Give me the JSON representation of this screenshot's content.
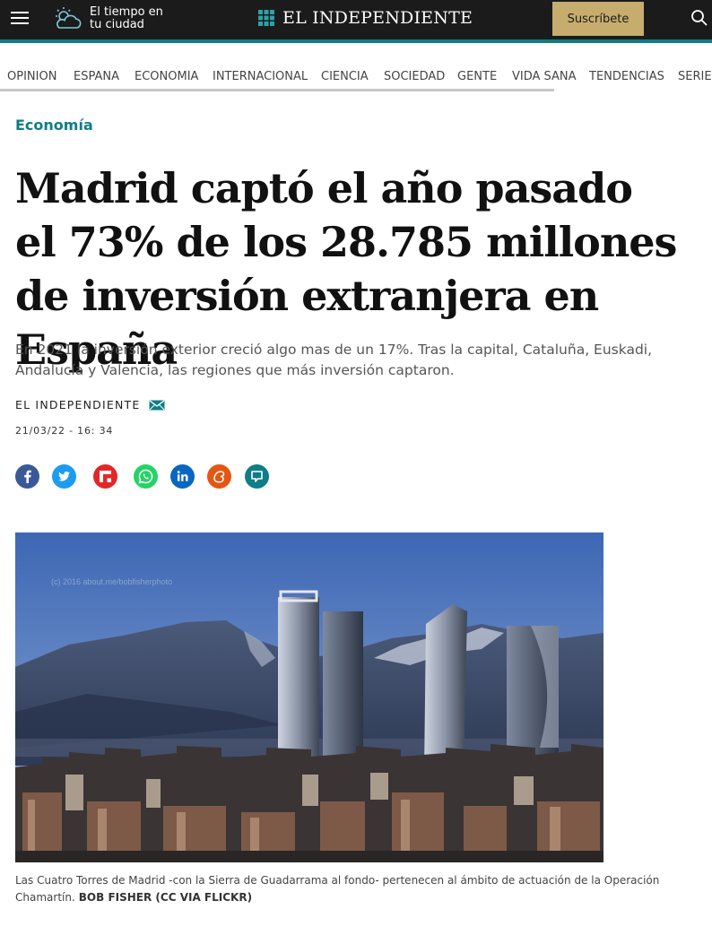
{
  "header": {
    "weather_line1": "El tiempo en",
    "weather_line2": "tu ciudad",
    "logo": "EL INDEPENDIENTE",
    "subscribe_label": "Suscríbete",
    "accent_color": "#0f7e86",
    "subscribe_color": "#c6ad6e"
  },
  "nav": {
    "items": [
      "OPINIÓN",
      "ESPAÑA",
      "ECONOMÍA",
      "INTERNACIONAL",
      "CIENCIA",
      "SOCIEDAD",
      "GENTE",
      "VIDA SANA",
      "TENDENCIAS",
      "SERIES"
    ]
  },
  "article": {
    "section": "Economía",
    "headline": "Madrid captó el año pasado el 73% de los 28.785 millones de inversión extranjera en España",
    "standfirst": "En 2021 la inversión exterior creció algo mas de un 17%. Tras la capital, Cataluña, Euskadi, Andalucía y Valencia, las regiones que más inversión captaron.",
    "author": "EL INDEPENDIENTE",
    "date": "21/03/22 - 16: 34",
    "photo_watermark": "(c) 2016 about.me/bobfisherphoto",
    "caption": "Las Cuatro Torres de Madrid -con la Sierra de Guadarrama al fondo- pertenecen al ámbito de actuación de la Operación Chamartín.",
    "credit": "BOB FISHER (CC VIA FLICKR)"
  },
  "share_buttons": [
    {
      "icon": "facebook-icon",
      "color": "#3b5998"
    },
    {
      "icon": "twitter-icon",
      "color": "#1d9bf0"
    },
    {
      "icon": "flipboard-icon",
      "color": "#e12828"
    },
    {
      "icon": "whatsapp-icon",
      "color": "#25d366"
    },
    {
      "icon": "linkedin-icon",
      "color": "#0a66c2"
    },
    {
      "icon": "meneame-icon",
      "color": "#e35614"
    },
    {
      "icon": "comments-icon",
      "color": "#0f7e86"
    }
  ]
}
